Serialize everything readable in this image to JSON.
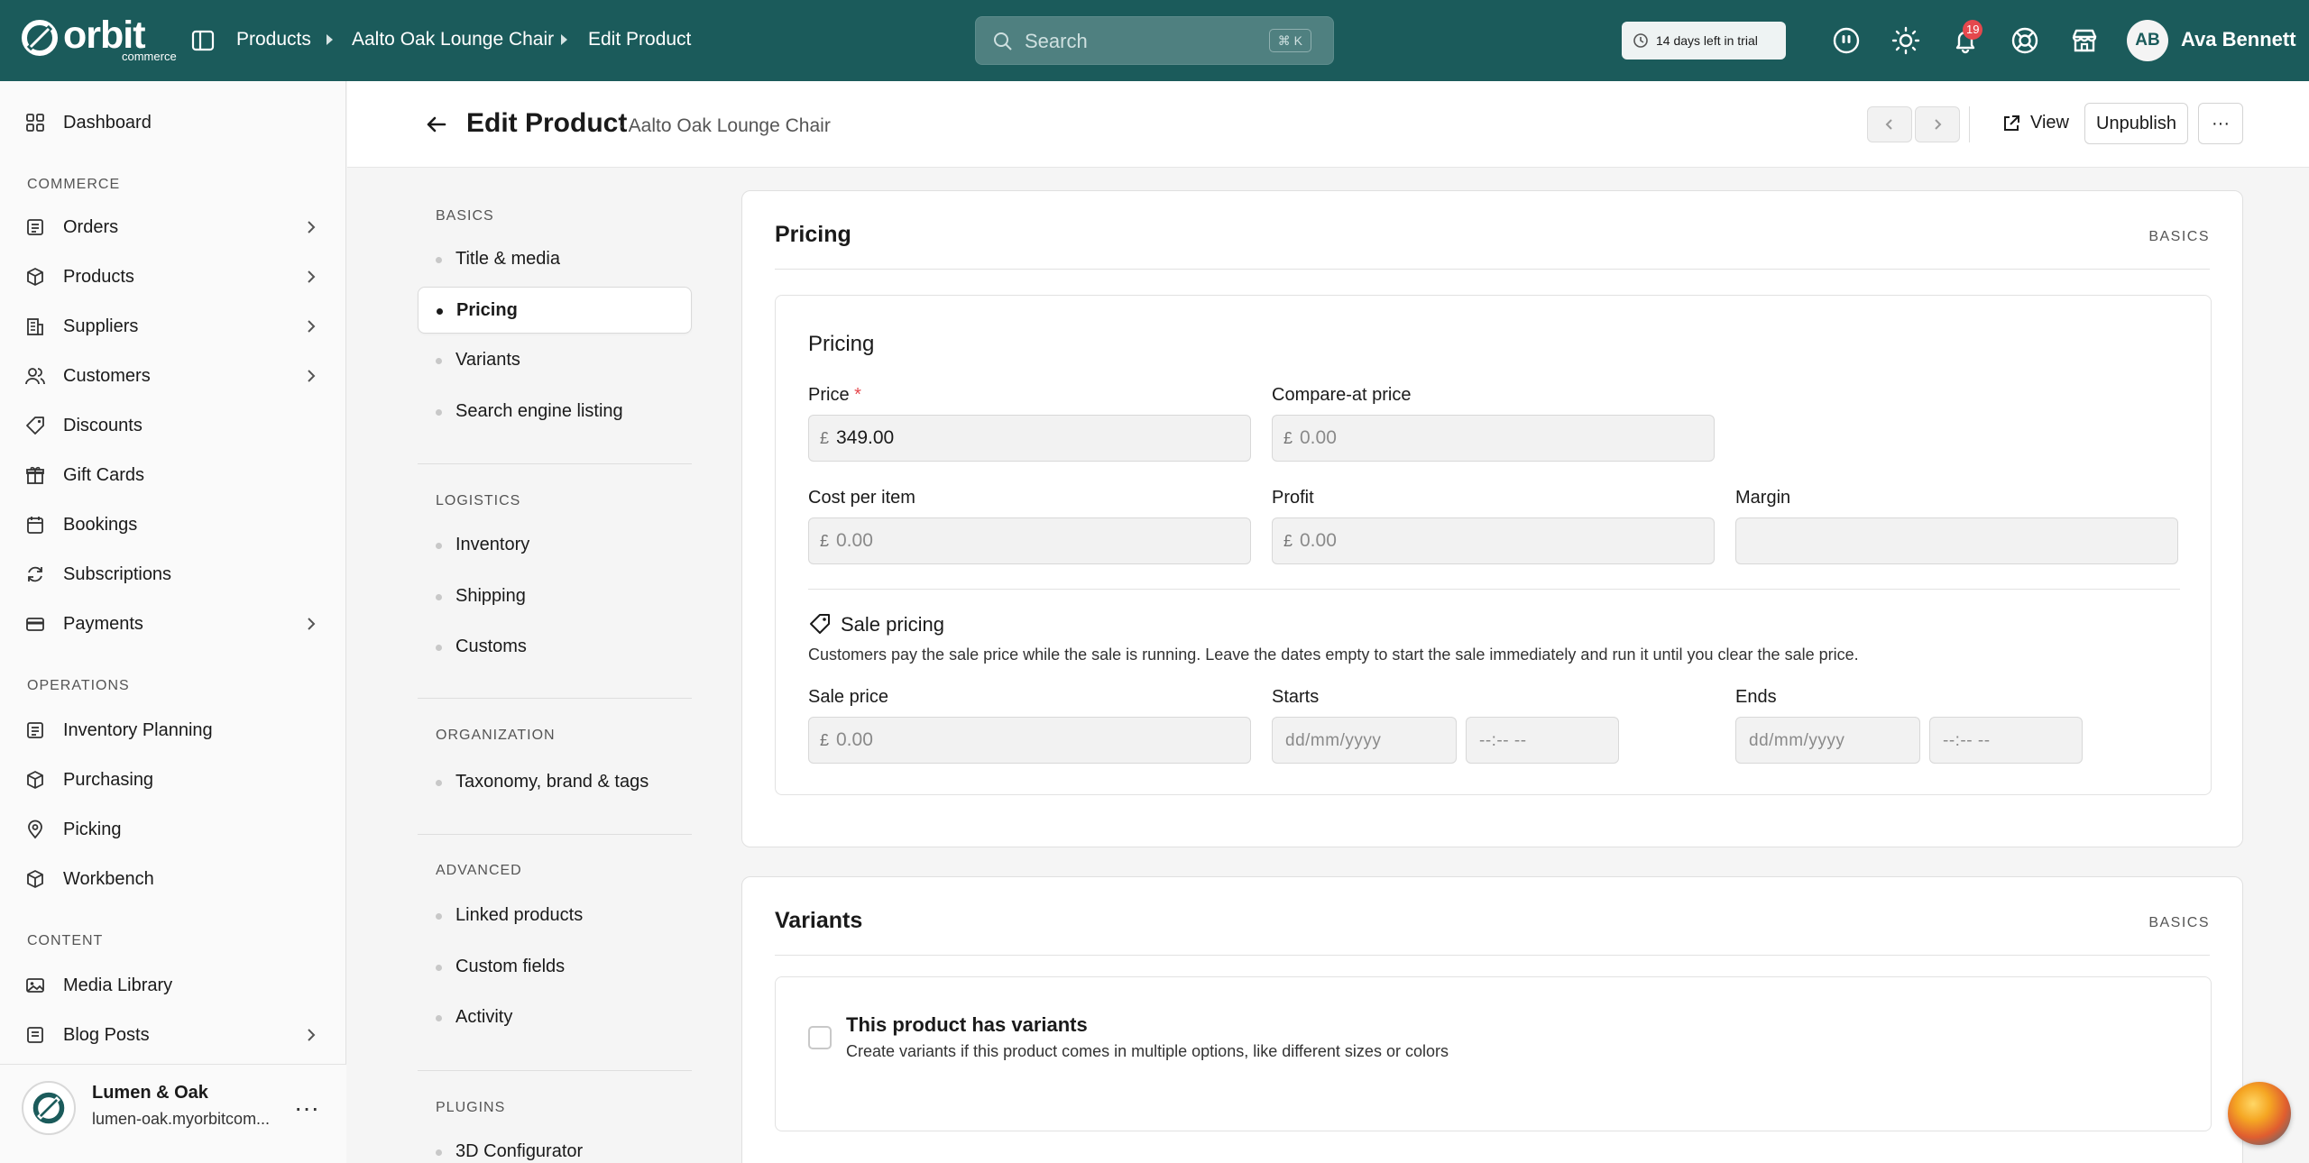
{
  "app": {
    "name": "orbit",
    "name_sub": "commerce"
  },
  "breadcrumb": [
    "Products",
    "Aalto Oak Lounge Chair",
    "Edit Product"
  ],
  "search": {
    "placeholder": "Search",
    "shortcut": "⌘ K"
  },
  "trial": {
    "label": "14 days left in trial"
  },
  "notifications": {
    "count": "19"
  },
  "user": {
    "initials": "AB",
    "name": "Ava Bennett"
  },
  "sidebar": {
    "dashboard": "Dashboard",
    "sections": {
      "commerce": "COMMERCE",
      "operations": "OPERATIONS",
      "content": "CONTENT"
    },
    "commerce": [
      "Orders",
      "Products",
      "Suppliers",
      "Customers",
      "Discounts",
      "Gift Cards",
      "Bookings",
      "Subscriptions",
      "Payments"
    ],
    "operations": [
      "Inventory Planning",
      "Purchasing",
      "Picking",
      "Workbench"
    ],
    "content": [
      "Media Library",
      "Blog Posts"
    ],
    "store": {
      "name": "Lumen & Oak",
      "domain": "lumen-oak.myorbitcom..."
    }
  },
  "header": {
    "title": "Edit Product",
    "subtitle": "· Aalto Oak Lounge Chair",
    "view_label": "View",
    "unpublish_label": "Unpublish",
    "more_label": "···"
  },
  "secnav": {
    "sections": {
      "basics": "BASICS",
      "logistics": "LOGISTICS",
      "organization": "ORGANIZATION",
      "advanced": "ADVANCED",
      "plugins": "PLUGINS"
    },
    "basics": [
      "Title & media",
      "Pricing",
      "Variants",
      "Search engine listing"
    ],
    "logistics": [
      "Inventory",
      "Shipping",
      "Customs"
    ],
    "organization": [
      "Taxonomy, brand & tags"
    ],
    "advanced": [
      "Linked products",
      "Custom fields",
      "Activity"
    ],
    "plugins": [
      "3D Configurator"
    ],
    "active": "Pricing"
  },
  "pricing_card": {
    "title": "Pricing",
    "tag": "BASICS",
    "inner_title": "Pricing",
    "currency": "£",
    "price": {
      "label": "Price",
      "required": "*",
      "value": "349.00"
    },
    "compare_at": {
      "label": "Compare-at price",
      "placeholder": "0.00"
    },
    "cost": {
      "label": "Cost per item",
      "placeholder": "0.00"
    },
    "profit": {
      "label": "Profit",
      "placeholder": "0.00"
    },
    "margin": {
      "label": "Margin",
      "value": ""
    },
    "sale": {
      "title": "Sale pricing",
      "description": "Customers pay the sale price while the sale is running. Leave the dates empty to start the sale immediately and run it until you clear the sale price.",
      "price_label": "Sale price",
      "price_placeholder": "0.00",
      "starts_label": "Starts",
      "ends_label": "Ends",
      "date_placeholder": "dd/mm/yyyy",
      "time_placeholder": "--:-- --"
    }
  },
  "variants_card": {
    "title": "Variants",
    "tag": "BASICS",
    "checkbox_label": "This product has variants",
    "checkbox_desc": "Create variants if this product comes in multiple options, like different sizes or colors",
    "checked": false
  },
  "colors": {
    "topbar": "#1b5b5b",
    "badge": "#e5484d",
    "required": "#e5484d"
  }
}
